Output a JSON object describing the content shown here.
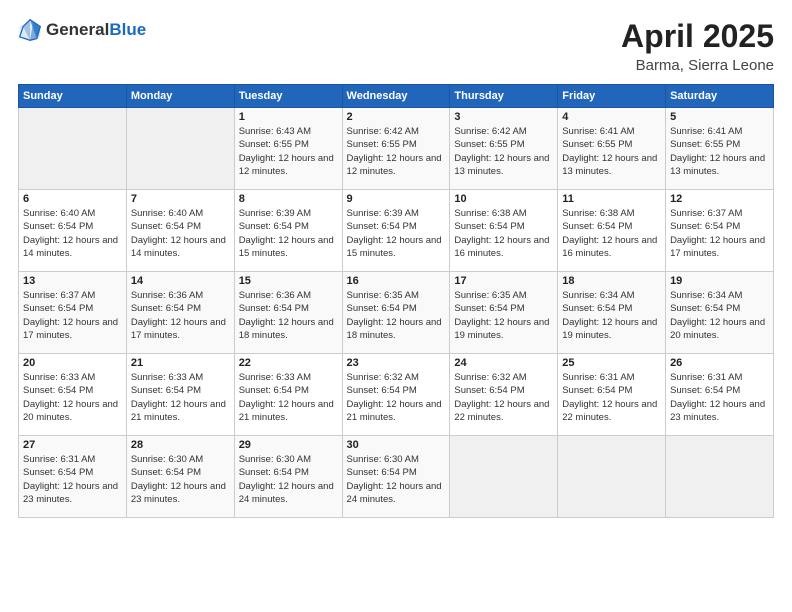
{
  "header": {
    "logo_general": "General",
    "logo_blue": "Blue",
    "title": "April 2025",
    "subtitle": "Barma, Sierra Leone"
  },
  "days_of_week": [
    "Sunday",
    "Monday",
    "Tuesday",
    "Wednesday",
    "Thursday",
    "Friday",
    "Saturday"
  ],
  "weeks": [
    [
      {
        "day": "",
        "info": ""
      },
      {
        "day": "",
        "info": ""
      },
      {
        "day": "1",
        "info": "Sunrise: 6:43 AM\nSunset: 6:55 PM\nDaylight: 12 hours and 12 minutes."
      },
      {
        "day": "2",
        "info": "Sunrise: 6:42 AM\nSunset: 6:55 PM\nDaylight: 12 hours and 12 minutes."
      },
      {
        "day": "3",
        "info": "Sunrise: 6:42 AM\nSunset: 6:55 PM\nDaylight: 12 hours and 13 minutes."
      },
      {
        "day": "4",
        "info": "Sunrise: 6:41 AM\nSunset: 6:55 PM\nDaylight: 12 hours and 13 minutes."
      },
      {
        "day": "5",
        "info": "Sunrise: 6:41 AM\nSunset: 6:55 PM\nDaylight: 12 hours and 13 minutes."
      }
    ],
    [
      {
        "day": "6",
        "info": "Sunrise: 6:40 AM\nSunset: 6:54 PM\nDaylight: 12 hours and 14 minutes."
      },
      {
        "day": "7",
        "info": "Sunrise: 6:40 AM\nSunset: 6:54 PM\nDaylight: 12 hours and 14 minutes."
      },
      {
        "day": "8",
        "info": "Sunrise: 6:39 AM\nSunset: 6:54 PM\nDaylight: 12 hours and 15 minutes."
      },
      {
        "day": "9",
        "info": "Sunrise: 6:39 AM\nSunset: 6:54 PM\nDaylight: 12 hours and 15 minutes."
      },
      {
        "day": "10",
        "info": "Sunrise: 6:38 AM\nSunset: 6:54 PM\nDaylight: 12 hours and 16 minutes."
      },
      {
        "day": "11",
        "info": "Sunrise: 6:38 AM\nSunset: 6:54 PM\nDaylight: 12 hours and 16 minutes."
      },
      {
        "day": "12",
        "info": "Sunrise: 6:37 AM\nSunset: 6:54 PM\nDaylight: 12 hours and 17 minutes."
      }
    ],
    [
      {
        "day": "13",
        "info": "Sunrise: 6:37 AM\nSunset: 6:54 PM\nDaylight: 12 hours and 17 minutes."
      },
      {
        "day": "14",
        "info": "Sunrise: 6:36 AM\nSunset: 6:54 PM\nDaylight: 12 hours and 17 minutes."
      },
      {
        "day": "15",
        "info": "Sunrise: 6:36 AM\nSunset: 6:54 PM\nDaylight: 12 hours and 18 minutes."
      },
      {
        "day": "16",
        "info": "Sunrise: 6:35 AM\nSunset: 6:54 PM\nDaylight: 12 hours and 18 minutes."
      },
      {
        "day": "17",
        "info": "Sunrise: 6:35 AM\nSunset: 6:54 PM\nDaylight: 12 hours and 19 minutes."
      },
      {
        "day": "18",
        "info": "Sunrise: 6:34 AM\nSunset: 6:54 PM\nDaylight: 12 hours and 19 minutes."
      },
      {
        "day": "19",
        "info": "Sunrise: 6:34 AM\nSunset: 6:54 PM\nDaylight: 12 hours and 20 minutes."
      }
    ],
    [
      {
        "day": "20",
        "info": "Sunrise: 6:33 AM\nSunset: 6:54 PM\nDaylight: 12 hours and 20 minutes."
      },
      {
        "day": "21",
        "info": "Sunrise: 6:33 AM\nSunset: 6:54 PM\nDaylight: 12 hours and 21 minutes."
      },
      {
        "day": "22",
        "info": "Sunrise: 6:33 AM\nSunset: 6:54 PM\nDaylight: 12 hours and 21 minutes."
      },
      {
        "day": "23",
        "info": "Sunrise: 6:32 AM\nSunset: 6:54 PM\nDaylight: 12 hours and 21 minutes."
      },
      {
        "day": "24",
        "info": "Sunrise: 6:32 AM\nSunset: 6:54 PM\nDaylight: 12 hours and 22 minutes."
      },
      {
        "day": "25",
        "info": "Sunrise: 6:31 AM\nSunset: 6:54 PM\nDaylight: 12 hours and 22 minutes."
      },
      {
        "day": "26",
        "info": "Sunrise: 6:31 AM\nSunset: 6:54 PM\nDaylight: 12 hours and 23 minutes."
      }
    ],
    [
      {
        "day": "27",
        "info": "Sunrise: 6:31 AM\nSunset: 6:54 PM\nDaylight: 12 hours and 23 minutes."
      },
      {
        "day": "28",
        "info": "Sunrise: 6:30 AM\nSunset: 6:54 PM\nDaylight: 12 hours and 23 minutes."
      },
      {
        "day": "29",
        "info": "Sunrise: 6:30 AM\nSunset: 6:54 PM\nDaylight: 12 hours and 24 minutes."
      },
      {
        "day": "30",
        "info": "Sunrise: 6:30 AM\nSunset: 6:54 PM\nDaylight: 12 hours and 24 minutes."
      },
      {
        "day": "",
        "info": ""
      },
      {
        "day": "",
        "info": ""
      },
      {
        "day": "",
        "info": ""
      }
    ]
  ]
}
